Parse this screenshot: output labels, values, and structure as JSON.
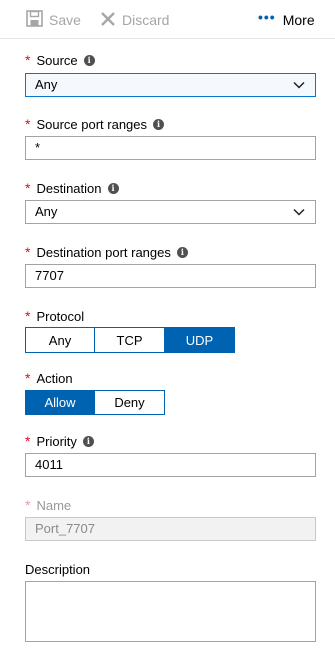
{
  "toolbar": {
    "save_label": "Save",
    "discard_label": "Discard",
    "more_label": "More",
    "more_dots": "•••"
  },
  "form": {
    "required_marker": "*",
    "info_glyph": "i",
    "source": {
      "label": "Source",
      "value": "Any"
    },
    "source_port_ranges": {
      "label": "Source port ranges",
      "value": "*"
    },
    "destination": {
      "label": "Destination",
      "value": "Any"
    },
    "destination_port_ranges": {
      "label": "Destination port ranges",
      "value": "7707"
    },
    "protocol": {
      "label": "Protocol",
      "options": [
        "Any",
        "TCP",
        "UDP"
      ],
      "selected": "UDP"
    },
    "action": {
      "label": "Action",
      "options": [
        "Allow",
        "Deny"
      ],
      "selected": "Allow"
    },
    "priority": {
      "label": "Priority",
      "value": "4011"
    },
    "name": {
      "label": "Name",
      "value": "Port_7707"
    },
    "description": {
      "label": "Description",
      "value": ""
    }
  },
  "colors": {
    "accent": "#0063b1",
    "required": "#e00b1c",
    "disabled_text": "#a6a6a6"
  },
  "icons": {
    "save": "save-icon",
    "discard": "close-icon",
    "more": "ellipsis-icon",
    "dropdown": "chevron-down-icon",
    "info": "info-icon"
  }
}
